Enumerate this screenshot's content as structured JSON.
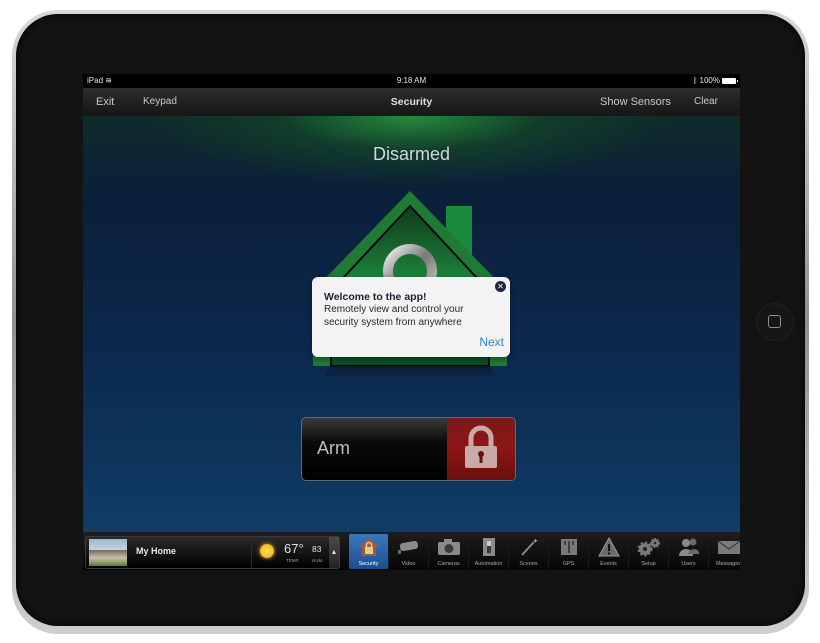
{
  "device": {
    "model_label": "iPad"
  },
  "statusbar": {
    "carrier": "iPad",
    "time": "9:18 AM",
    "battery": "100%"
  },
  "navbar": {
    "exit": "Exit",
    "keypad": "Keypad",
    "title": "Security",
    "show_sensors": "Show Sensors",
    "clear": "Clear"
  },
  "main": {
    "status": "Disarmed",
    "arm_button": {
      "label": "Arm",
      "icon": "lock-icon"
    },
    "colors": {
      "disarmed_green": "#1f7a35",
      "arm_red": "#8e1515",
      "link_blue": "#2b8ac2"
    }
  },
  "popup": {
    "title": "Welcome to the app!",
    "body": "Remotely view and control your security system  from anywhere",
    "next": "Next",
    "close_icon": "close-icon"
  },
  "homecard": {
    "name": "My Home",
    "weather_icon": "sun-icon",
    "temperature": "67°",
    "temperature_label": "TEMP.",
    "humidity": "83",
    "humidity_label": "HUM."
  },
  "tabs": [
    {
      "label": "Security",
      "icon": "house-lock-icon",
      "active": true
    },
    {
      "label": "Video",
      "icon": "video-camera-icon",
      "active": false
    },
    {
      "label": "Cameras",
      "icon": "camera-icon",
      "active": false
    },
    {
      "label": "Automation",
      "icon": "switch-icon",
      "active": false
    },
    {
      "label": "Scenes",
      "icon": "magic-wand-icon",
      "active": false
    },
    {
      "label": "GPS",
      "icon": "map-icon",
      "active": false
    },
    {
      "label": "Events",
      "icon": "warning-icon",
      "active": false
    },
    {
      "label": "Setup",
      "icon": "gears-icon",
      "active": false
    },
    {
      "label": "Users",
      "icon": "users-icon",
      "active": false
    },
    {
      "label": "Messages",
      "icon": "envelope-icon",
      "active": false
    }
  ]
}
